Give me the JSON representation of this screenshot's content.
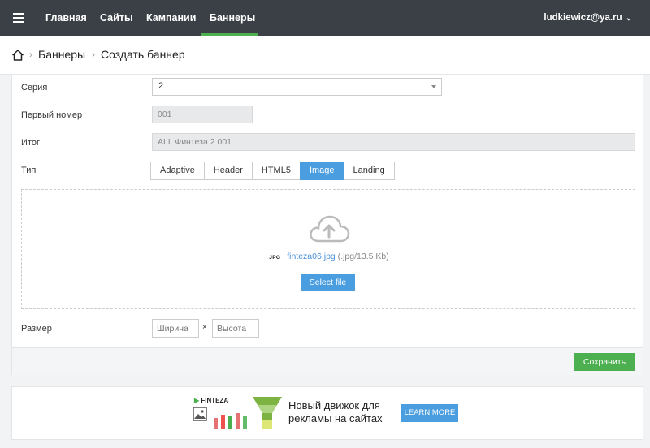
{
  "nav": {
    "items": [
      {
        "label": "Главная"
      },
      {
        "label": "Сайты"
      },
      {
        "label": "Кампании"
      },
      {
        "label": "Баннеры"
      }
    ],
    "active_index": 3,
    "user": "ludkiewicz@ya.ru"
  },
  "breadcrumb": {
    "items": [
      "Баннеры",
      "Создать баннер"
    ]
  },
  "form": {
    "series_label": "Серия",
    "series_value": "2",
    "first_number_label": "Первый номер",
    "first_number_value": "001",
    "total_label": "Итог",
    "total_value": "ALL Финтеза 2 001",
    "type_label": "Тип",
    "types": [
      "Adaptive",
      "Header",
      "HTML5",
      "Image",
      "Landing"
    ],
    "active_type": "Image",
    "upload": {
      "file_tag": "JPG",
      "file_name": "finteza06.jpg",
      "file_meta": "(.jpg/13.5 Kb)",
      "select_label": "Select file"
    },
    "size_label": "Размер",
    "width_placeholder": "Ширина",
    "height_placeholder": "Высота",
    "times_sign": "×",
    "save_label": "Сохранить"
  },
  "ad": {
    "logo": "FINTEZA",
    "text_line1": "Новый движок для",
    "text_line2": "рекламы на сайтах",
    "button": "LEARN MORE"
  },
  "colors": {
    "topbar": "#3a4045",
    "accent_green": "#4caf50",
    "accent_blue": "#4a9ee0"
  }
}
